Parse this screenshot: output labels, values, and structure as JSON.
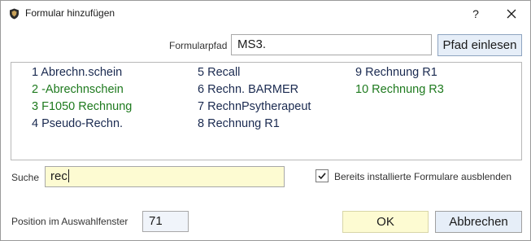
{
  "window": {
    "title": "Formular hinzufügen",
    "help_glyph": "?",
    "close_glyph": "✕"
  },
  "pfad": {
    "label": "Formularpfad",
    "value": "MS3.",
    "button_label": "Pfad einlesen"
  },
  "list": {
    "columns": [
      [
        {
          "text": "1 Abrechn.schein",
          "color": "#1a2a50"
        },
        {
          "text": "2 -Abrechnschein",
          "color": "#1e7a1e"
        },
        {
          "text": "3 F1050 Rechnung",
          "color": "#1e7a1e"
        },
        {
          "text": "4 Pseudo-Rechn.",
          "color": "#1a2a50"
        }
      ],
      [
        {
          "text": "5 Recall",
          "color": "#1a2a50"
        },
        {
          "text": "6 Rechn. BARMER",
          "color": "#1a2a50"
        },
        {
          "text": "7 RechnPsytherapeut",
          "color": "#1a2a50"
        },
        {
          "text": "8 Rechnung R1",
          "color": "#1a2a50"
        }
      ],
      [
        {
          "text": "9 Rechnung R1",
          "color": "#1a2a50"
        },
        {
          "text": "10 Rechnung R3",
          "color": "#1e7a1e"
        }
      ]
    ]
  },
  "suche": {
    "label": "Suche",
    "value": "rec"
  },
  "filter": {
    "checked": true,
    "label": "Bereits installierte Formulare ausblenden"
  },
  "position": {
    "label": "Position im Auswahlfenster",
    "value": "71"
  },
  "buttons": {
    "ok": "OK",
    "cancel": "Abbrechen"
  },
  "colors": {
    "field_highlight": "#fdfbd2",
    "button_blue": "#e6eef8",
    "list_green": "#1e7a1e",
    "list_navy": "#1a2a50"
  }
}
